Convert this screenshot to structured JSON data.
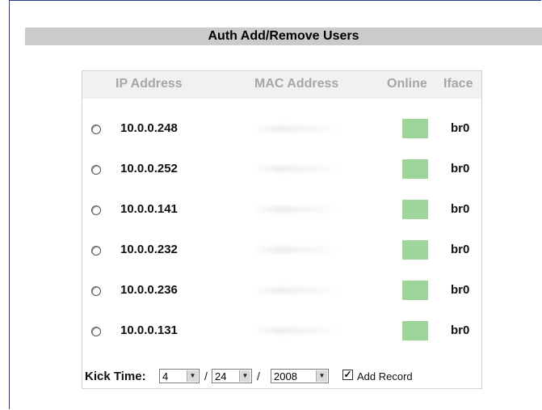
{
  "title": "Auth Add/Remove Users",
  "table": {
    "headers": {
      "ip": "IP Address",
      "mac": "MAC Address",
      "online": "Online",
      "iface": "Iface"
    },
    "online_color": "#9ed69a",
    "rows": [
      {
        "ip": "10.0.0.248",
        "mac": "",
        "iface": "br0"
      },
      {
        "ip": "10.0.0.252",
        "mac": "",
        "iface": "br0"
      },
      {
        "ip": "10.0.0.141",
        "mac": "",
        "iface": "br0"
      },
      {
        "ip": "10.0.0.232",
        "mac": "",
        "iface": "br0"
      },
      {
        "ip": "10.0.0.236",
        "mac": "",
        "iface": "br0"
      },
      {
        "ip": "10.0.0.131",
        "mac": "",
        "iface": "br0"
      }
    ]
  },
  "kick": {
    "label": "Kick Time:",
    "month": "4",
    "day": "24",
    "year": "2008",
    "separator": "/",
    "add_record_label": "Add Record",
    "add_record_checked": true
  }
}
